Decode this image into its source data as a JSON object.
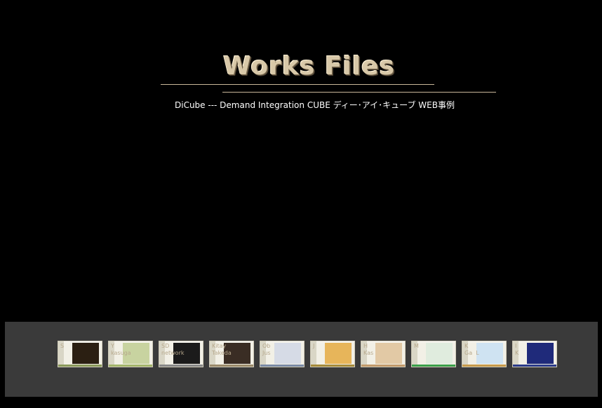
{
  "header": {
    "title": "Works Files",
    "subtitle": "DiCube --- Demand Integration CUBE ディー･アイ･キューブ  WEB事例"
  },
  "thumbnails": [
    {
      "label": "S",
      "accent": "#8a9a5a",
      "shot": "#2b1f12"
    },
    {
      "label": "Y\nkasuga",
      "accent": "#a3b56a",
      "shot": "#c8d3a0"
    },
    {
      "label": "SD\nnetwork",
      "accent": "#888888",
      "shot": "#1b1b1b"
    },
    {
      "label": "Kitay\nTakeda",
      "accent": "#9b8a6a",
      "shot": "#3a2d24"
    },
    {
      "label": "Ob\nJus",
      "accent": "#7a8aa6",
      "shot": "#d6dbe6"
    },
    {
      "label": "J",
      "accent": "#a58a3a",
      "shot": "#e7b55a"
    },
    {
      "label": "H\nKas",
      "accent": "#c29a6a",
      "shot": "#e2c9a5"
    },
    {
      "label": "M",
      "accent": "#3aa04a",
      "shot": "#e0ecde"
    },
    {
      "label": "K\nGa  L",
      "accent": "#c79a4a",
      "shot": "#cfe3f2"
    },
    {
      "label": "I\nK",
      "accent": "#2a3a8a",
      "shot": "#1f2a7a"
    }
  ]
}
